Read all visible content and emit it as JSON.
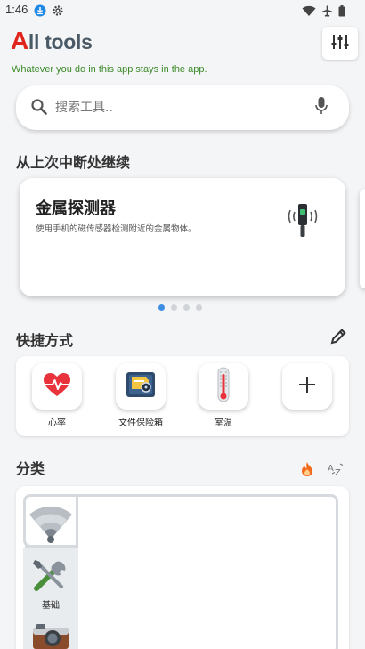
{
  "status_bar": {
    "time": "1:46",
    "left_icons": [
      "download-icon",
      "gear-icon"
    ],
    "right_icons": [
      "wifi-icon",
      "airplane-icon",
      "battery-icon"
    ]
  },
  "header": {
    "title_first_letter": "A",
    "title_rest": "ll tools",
    "tagline": "Whatever you do in this app stays in the app.",
    "settings_icon": "sliders-icon"
  },
  "search": {
    "placeholder": "搜索工具..",
    "value": "",
    "left_icon": "search-icon",
    "right_icon": "microphone-icon"
  },
  "continue_section": {
    "title": "从上次中断处继续",
    "card": {
      "title": "金属探测器",
      "description": "使用手机的磁传感器检测附近的金属物体。",
      "icon": "metal-detector-icon"
    },
    "dots_count": 4,
    "active_dot": 0
  },
  "shortcuts_section": {
    "title": "快捷方式",
    "edit_icon": "pencil-icon",
    "items": [
      {
        "label": "心率",
        "icon": "heart-rate-icon"
      },
      {
        "label": "文件保险箱",
        "icon": "file-vault-icon"
      },
      {
        "label": "室温",
        "icon": "thermometer-icon"
      },
      {
        "label": "",
        "icon": "plus-icon"
      }
    ]
  },
  "categories_section": {
    "title": "分类",
    "sort_icons": [
      "flame-icon",
      "az-sort-icon"
    ],
    "items": [
      {
        "label": "",
        "icon": "wifi-signal-icon"
      },
      {
        "label": "基础",
        "icon": "tools-icon"
      },
      {
        "label": "",
        "icon": "camera-icon"
      }
    ]
  },
  "colors": {
    "brand_red": "#e0261c",
    "tagline_green": "#3c8a28",
    "dot_active": "#3d8fe4",
    "heart_red": "#e8323c",
    "flame_orange": "#f26b1d"
  }
}
